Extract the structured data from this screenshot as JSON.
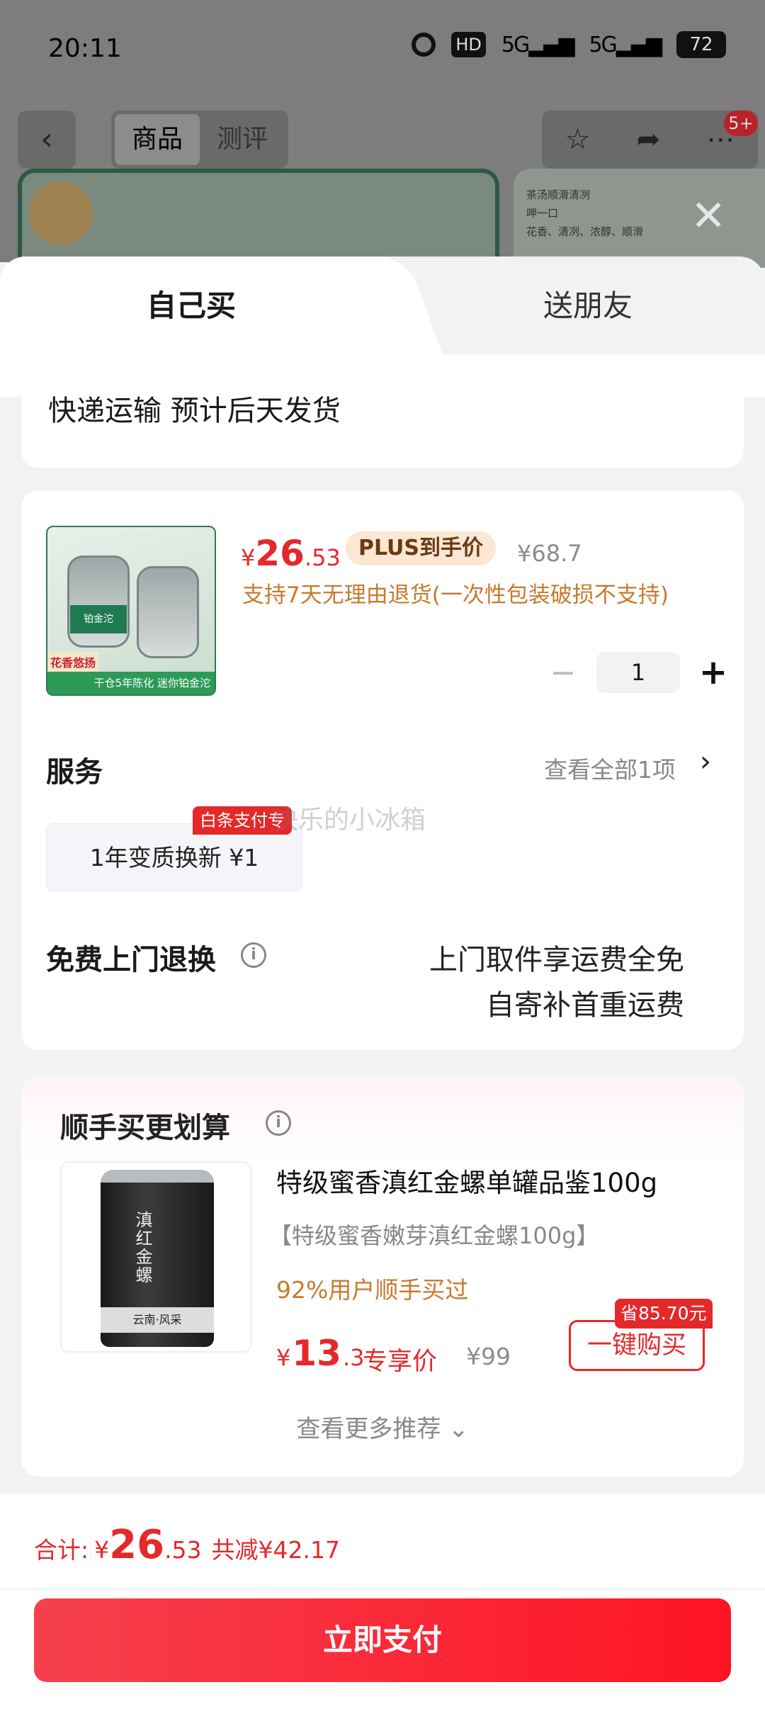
{
  "status_bar": {
    "time": "20:11",
    "hd_label": "HD",
    "signal_1": "5G",
    "signal_2": "5G",
    "battery": "72"
  },
  "nav": {
    "back_glyph": "‹",
    "tabs": [
      "商品",
      "测评"
    ],
    "more_badge": "5+"
  },
  "background": {
    "promo_lines": [
      "茶汤顺滑清冽",
      "呷一口",
      "花香、清冽、浓醇、顺滑"
    ]
  },
  "sheet": {
    "tab_self": "自己买",
    "tab_gift": "送朋友",
    "shipping": "快递运输 预计后天发货",
    "item": {
      "thumb_flower": "花香悠扬",
      "thumb_band": "干仓5年陈化 迷你铂金沱",
      "jar_label": "铂金沱",
      "price_currency": "¥",
      "price_int": "26",
      "price_dec": ".53",
      "plus_label": "PLUS到手价",
      "original_price": "¥68.7",
      "returns_text": "支持7天无理由退货(一次性包装破损不支持)",
      "quantity": "1",
      "minus": "−",
      "plus": "+"
    },
    "service": {
      "title": "服务",
      "view_all": "查看全部1项",
      "chevron": "›",
      "chip": "1年变质换新 ¥1",
      "tag": "白条支付专",
      "watermark": "快乐的小冰箱"
    },
    "free_return": {
      "title": "免费上门退换",
      "info": "i",
      "line1": "上门取件享运费全免",
      "line2": "自寄补首重运费"
    },
    "reco": {
      "title": "顺手买更划算",
      "info": "i",
      "can_text": "滇红金螺",
      "can_band": "云南·风采",
      "name": "特级蜜香滇红金螺单罐品鉴100g",
      "sub": "【特级蜜香嫩芽滇红金螺100g】",
      "pct": "92%用户顺手买过",
      "price_currency": "¥",
      "price_int": "13",
      "price_dec": ".3",
      "exclusive": "专享价",
      "original": "¥99",
      "save_tag": "省85.70元",
      "buy_btn": "一键购买",
      "more": "查看更多推荐 ⌄"
    }
  },
  "footer": {
    "total_label": "合计:",
    "currency": "¥",
    "total_int": "26",
    "total_dec": ".53",
    "discount": "共减¥42.17",
    "pay_btn": "立即支付"
  },
  "colors": {
    "accent_red": "#e4292b",
    "returns_orange": "#c77a2d",
    "plus_bg": "#fbe7d3"
  }
}
